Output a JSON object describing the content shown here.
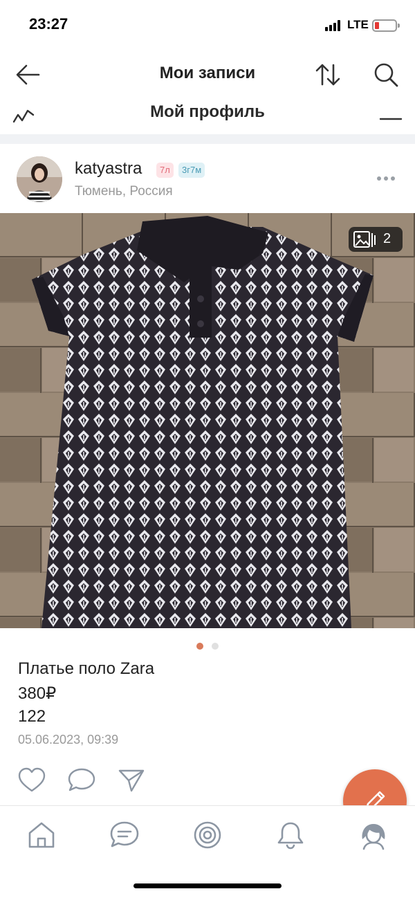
{
  "status_bar": {
    "time": "23:27",
    "network": "LTE",
    "battery_level": 0.15
  },
  "nav": {
    "title": "Мои записи"
  },
  "behind_header": {
    "title": "Мой профиль"
  },
  "post": {
    "username": "katyastra",
    "badge_age": "7л",
    "badge_time": "3г7м",
    "location": "Тюмень, Россия",
    "photo_count": "2",
    "current_photo": 1,
    "total_photos": 2,
    "title": "Платье поло Zara",
    "price": "380₽",
    "size": "122",
    "date": "05.06.2023, 09:39"
  },
  "icons": {
    "back": "arrow-left-icon",
    "sort": "sort-arrows-icon",
    "search": "search-icon",
    "more": "more-dots-icon",
    "gallery": "image-stack-icon",
    "like": "heart-icon",
    "comment": "comment-bubble-icon",
    "share": "send-icon",
    "edit": "pencil-icon",
    "tabs": [
      "home-icon",
      "messages-icon",
      "target-icon",
      "bell-icon",
      "profile-icon"
    ]
  },
  "colors": {
    "accent": "#e2714d",
    "active_dot": "#d97a5a",
    "inactive_dot": "#e0e0e0",
    "icon_gray": "#8c96a3",
    "badge_age_bg": "#fde3e6",
    "badge_time_bg": "#dff1f6"
  }
}
